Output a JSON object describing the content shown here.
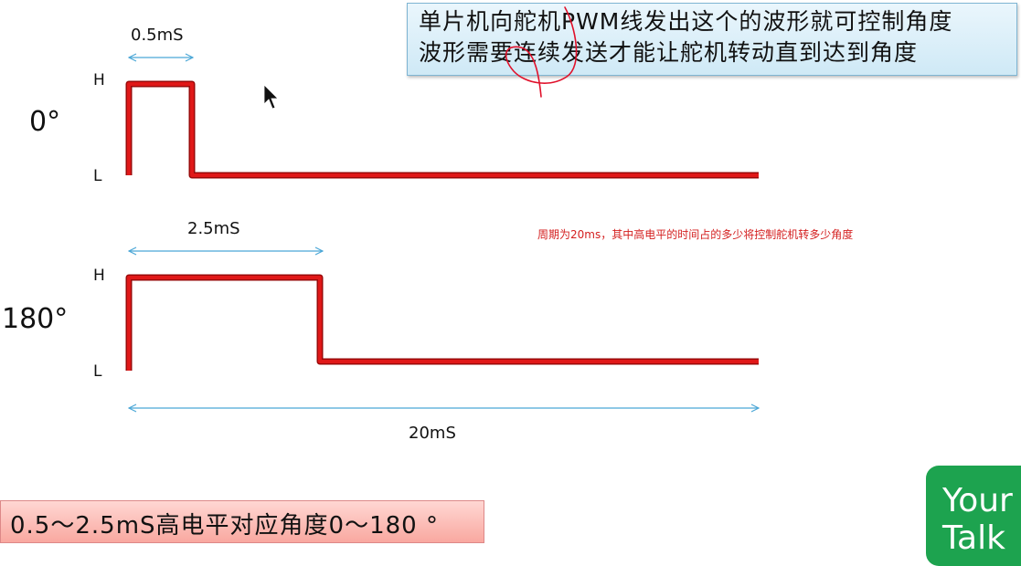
{
  "note": {
    "line1": "单片机向舵机PWM线发出这个的波形就可控制角度",
    "line2": "波形需要连续发送才能让舵机转动直到达到角度"
  },
  "waveform_top": {
    "angle_label": "0°",
    "high_label": "H",
    "low_label": "L",
    "pulse_width_label": "0.5mS"
  },
  "waveform_bottom": {
    "angle_label": "180°",
    "high_label": "H",
    "low_label": "L",
    "pulse_width_label": "2.5mS",
    "period_label": "20mS"
  },
  "red_note": "周期为20ms，其中高电平的时间占的多少将控制舵机转多少角度",
  "summary": "0.5～2.5mS高电平对应角度0～180 °",
  "corner_card": {
    "line1": "Your",
    "line2": "Talk"
  },
  "colors": {
    "wave": "#d01010",
    "dimension_arrow": "#4aa6d6",
    "annotation_scribble": "#e0102a"
  }
}
